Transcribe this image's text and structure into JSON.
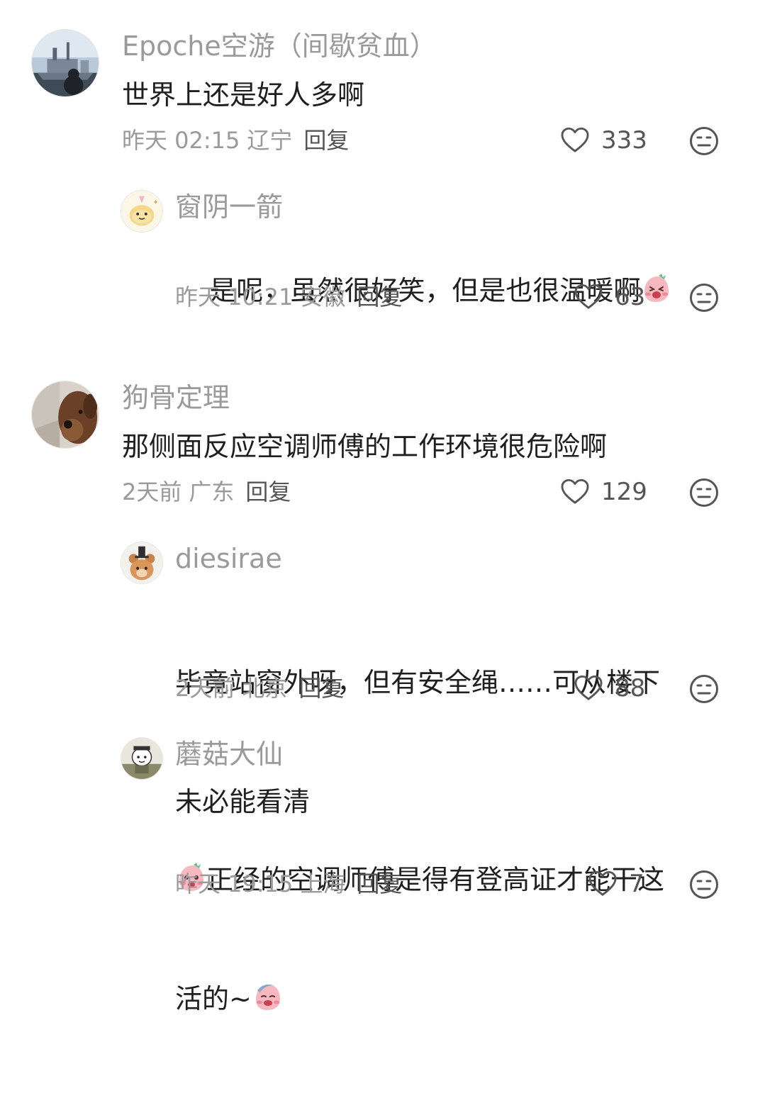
{
  "comments": [
    {
      "username": "Epoche空游（间歇贫血）",
      "text": "世界上还是好人多啊",
      "time": "昨天 02:15",
      "location": "辽宁",
      "reply_label": "回复",
      "likes": "333",
      "avatar": "warship-avatar"
    },
    {
      "username": "窗阴一箭",
      "text": "是呢，虽然很好笑，但是也很温暖啊",
      "time": "昨天 10:21",
      "location": "安徽",
      "reply_label": "回复",
      "likes": "63",
      "avatar": "apple-cartoon-avatar"
    },
    {
      "username": "狗骨定理",
      "text": "那侧面反应空调师傅的工作环境很危险啊",
      "time": "2天前",
      "location": "广东",
      "reply_label": "回复",
      "likes": "129",
      "avatar": "dog-photo-avatar"
    },
    {
      "username": "diesirae",
      "text_line1": "毕竟站窗外呀，但有安全绳……可从楼下",
      "text_line2": "未必能看清",
      "time": "2天前",
      "location": "北京",
      "reply_label": "回复",
      "likes": "88",
      "avatar": "bear-cartoon-avatar"
    },
    {
      "username": "蘑菇大仙",
      "text_line1": "正经的空调师傅是得有登高证才能干这",
      "text_line2": "活的~",
      "time": "昨天 19:15",
      "location": "上海",
      "reply_label": "回复",
      "likes": "7",
      "avatar": "cartoon-character-avatar"
    }
  ],
  "colors": {
    "meta_text": "#9a9a9a",
    "body_text": "#1f1f1f",
    "icon_stroke": "#555555"
  },
  "icons": {
    "like": "heart-outline-icon",
    "dislike": "neutral-face-icon",
    "emoji": "pink-blush-face-emoji"
  }
}
